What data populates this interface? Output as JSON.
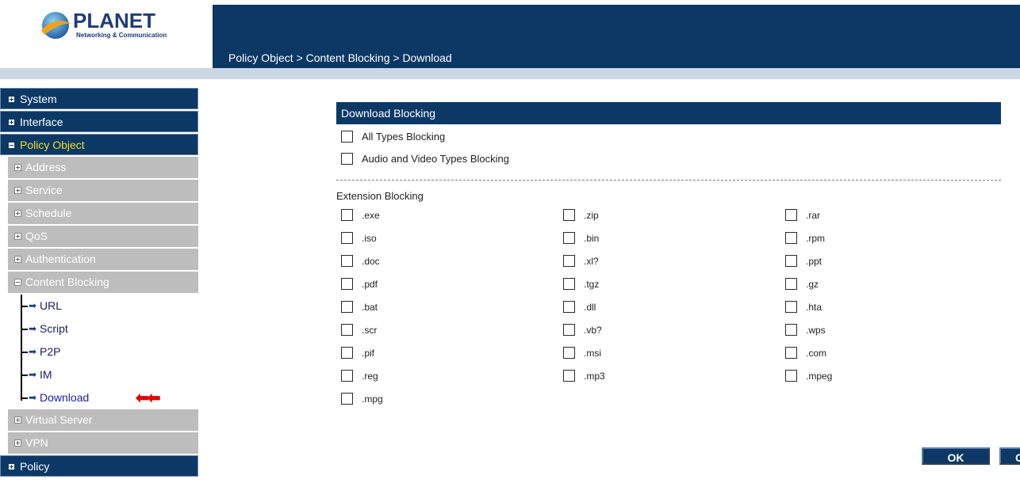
{
  "header": {
    "logo_text": "PLANET",
    "logo_sub": "Networking & Communication",
    "breadcrumb": "Policy Object > Content Blocking > Download"
  },
  "sidebar": {
    "top_items": [
      {
        "label": "System"
      },
      {
        "label": "Interface"
      },
      {
        "label": "Policy Object"
      }
    ],
    "sub_items": [
      {
        "label": "Address"
      },
      {
        "label": "Service"
      },
      {
        "label": "Schedule"
      },
      {
        "label": "QoS"
      },
      {
        "label": "Authentication"
      },
      {
        "label": "Content Blocking"
      }
    ],
    "leaves": [
      {
        "label": "URL"
      },
      {
        "label": "Script"
      },
      {
        "label": "P2P"
      },
      {
        "label": "IM"
      },
      {
        "label": "Download"
      }
    ],
    "after_sub_items": [
      {
        "label": "Virtual Server"
      },
      {
        "label": "VPN"
      }
    ],
    "bottom_items": [
      {
        "label": "Policy"
      }
    ],
    "active_top": "Policy Object",
    "current_leaf": "Download"
  },
  "panel": {
    "title": "Download Blocking",
    "options": [
      {
        "label": "All Types Blocking",
        "checked": false
      },
      {
        "label": "Audio and Video Types Blocking",
        "checked": false
      }
    ],
    "extension_label": "Extension Blocking",
    "extensions": [
      [
        ".exe",
        ".zip",
        ".rar"
      ],
      [
        ".iso",
        ".bin",
        ".rpm"
      ],
      [
        ".doc",
        ".xl?",
        ".ppt"
      ],
      [
        ".pdf",
        ".tgz",
        ".gz"
      ],
      [
        ".bat",
        ".dll",
        ".hta"
      ],
      [
        ".scr",
        ".vb?",
        ".wps"
      ],
      [
        ".pif",
        ".msi",
        ".com"
      ],
      [
        ".reg",
        ".mp3",
        ".mpeg"
      ],
      [
        ".mpg"
      ]
    ]
  },
  "buttons": {
    "ok": "OK",
    "cancel": "Cancel"
  },
  "colors": {
    "navy": "#0c3866",
    "gray_menu": "#bdbdbd",
    "active_text": "#f4dd2a",
    "pointer_arrows": "#e60000"
  }
}
